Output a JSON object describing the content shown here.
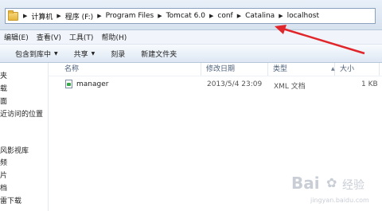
{
  "address": {
    "crumbs": [
      "计算机",
      "程序 (F:)",
      "Program Files",
      "Tomcat 6.0",
      "conf",
      "Catalina",
      "localhost"
    ]
  },
  "menubar": {
    "items": [
      "编辑(E)",
      "查看(V)",
      "工具(T)",
      "帮助(H)"
    ]
  },
  "toolbar": {
    "include_library": "包含到库中",
    "share": "共享",
    "burn": "刻录",
    "new_folder": "新建文件夹"
  },
  "sidebar": {
    "items": [
      "夹",
      "载",
      "面",
      "近访问的位置",
      "风影视库",
      "频",
      "片",
      "档",
      "雷下载"
    ]
  },
  "columns": {
    "name": "名称",
    "modified": "修改日期",
    "type": "类型",
    "size": "大小"
  },
  "files": [
    {
      "name": "manager",
      "modified": "2013/5/4 23:09",
      "type": "XML 文档",
      "size": "1 KB"
    }
  ],
  "watermark": {
    "brand": "Bai",
    "brand2": "经验",
    "url": "jingyan.baidu.com"
  },
  "colors": {
    "arrow": "#e0262a",
    "accent": "#4c607a"
  },
  "icons": [
    "folder-icon",
    "chevron-right-icon",
    "chevron-down-icon",
    "xml-file-icon",
    "sort-up-icon"
  ]
}
